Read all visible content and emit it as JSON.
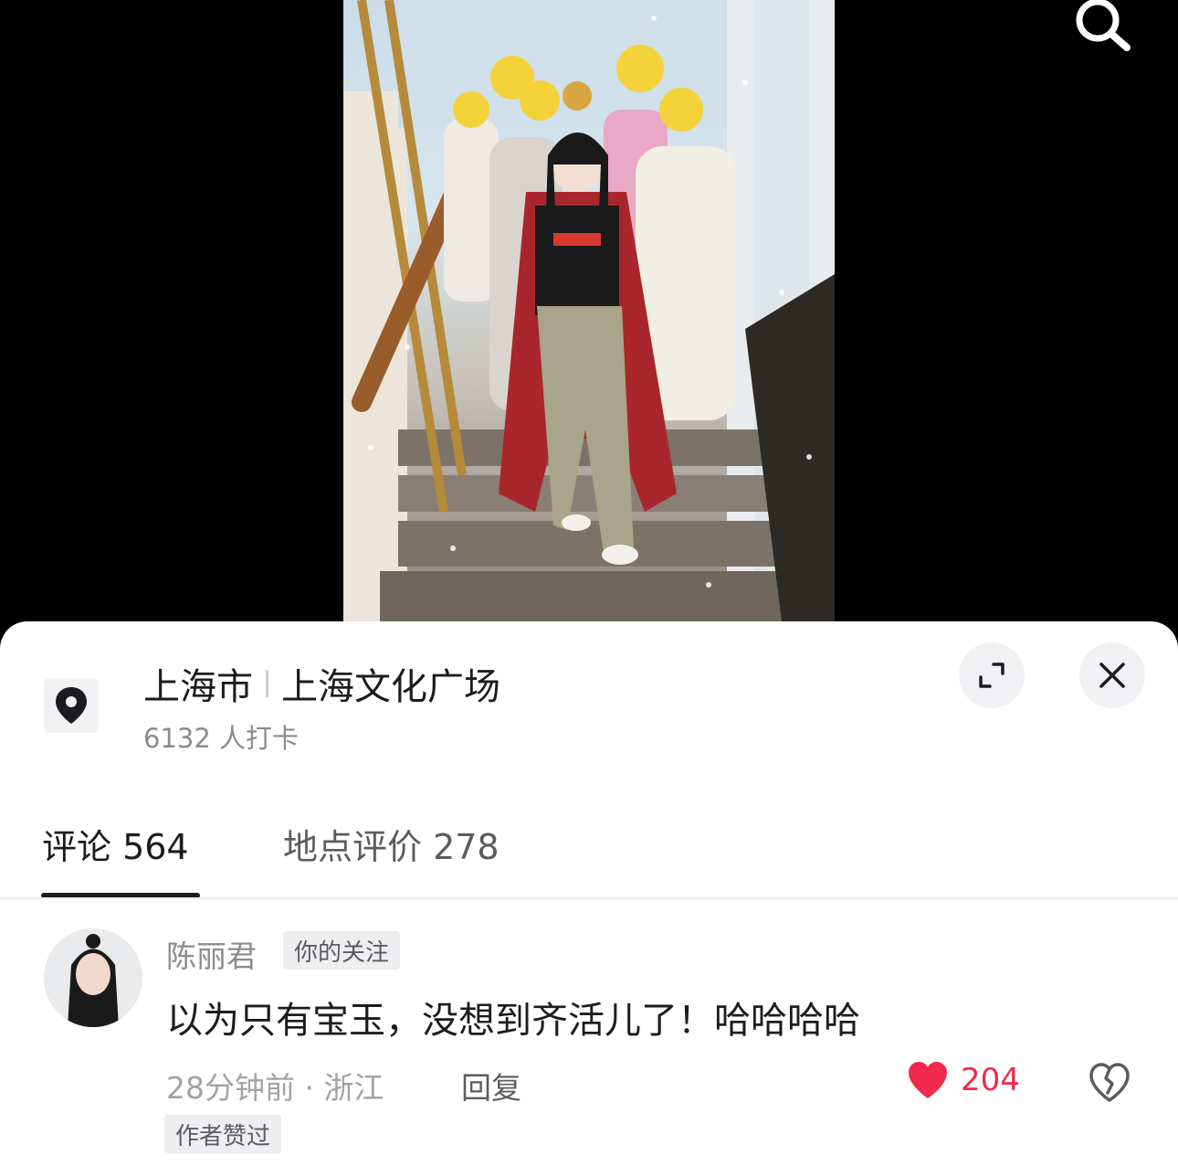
{
  "location": {
    "city": "上海市",
    "place": "上海文化广场",
    "checkins": "6132 人打卡"
  },
  "icons": {
    "search": "search-icon",
    "location": "map-pin-icon",
    "expand": "expand-icon",
    "close": "close-icon",
    "like": "heart-icon",
    "dislike": "broken-heart-icon"
  },
  "tabs": [
    {
      "label": "评论 564",
      "active": true
    },
    {
      "label": "地点评价 278",
      "active": false
    }
  ],
  "comment": {
    "author": "陈丽君",
    "badge": "你的关注",
    "text": "以为只有宝玉，没想到齐活儿了！哈哈哈哈",
    "meta": "28分钟前 · 浙江",
    "reply_label": "回复",
    "likes": "204",
    "author_badge": "作者赞过"
  },
  "colors": {
    "like_red": "#f0294d",
    "text_primary": "#1c1c1e",
    "text_secondary": "#8a8a8f"
  }
}
